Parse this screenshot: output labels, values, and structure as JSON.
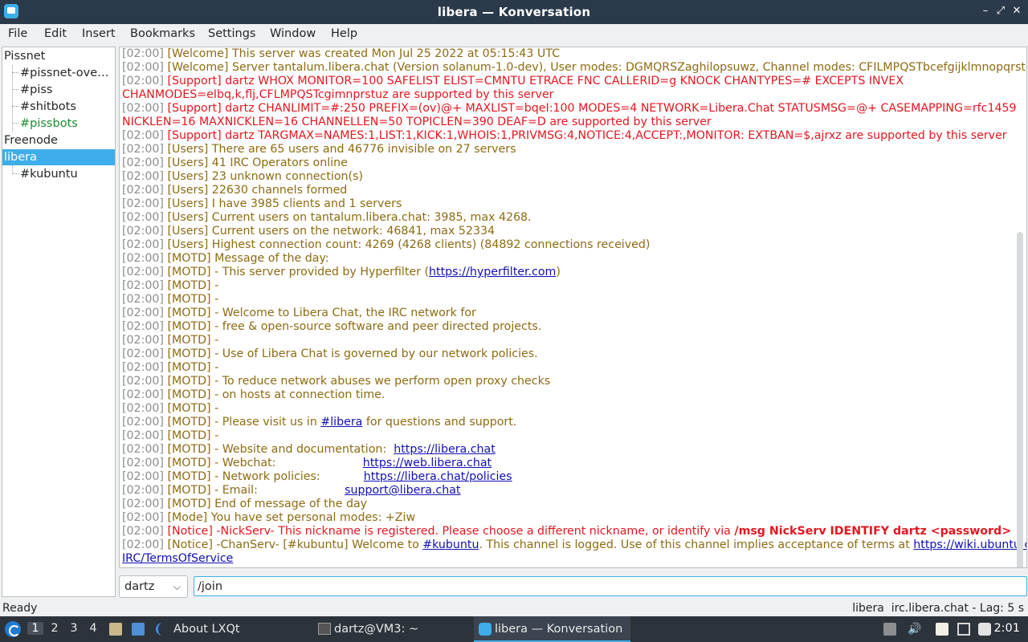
{
  "window": {
    "title": "libera — Konversation"
  },
  "menubar": [
    "File",
    "Edit",
    "Insert",
    "Bookmarks",
    "Settings",
    "Window",
    "Help"
  ],
  "tree": {
    "servers": [
      {
        "name": "Pissnet",
        "channels": [
          "#pissnet-over…",
          "#piss",
          "#shitbots",
          "#pissbots"
        ]
      },
      {
        "name": "Freenode",
        "channels": []
      },
      {
        "name": "libera",
        "channels": [
          "#kubuntu"
        ]
      }
    ]
  },
  "chat": {
    "lines": [
      {
        "ts": "[02:00]",
        "tag": "[Welcome]",
        "text": " This server was created Mon Jul 25 2022 at 05:15:43 UTC",
        "style": "info"
      },
      {
        "ts": "[02:00]",
        "tag": "[Welcome]",
        "text": " Server tantalum.libera.chat (Version solanum-1.0-dev), User modes: DGMQRSZaghilopsuwz, Channel modes: CFILMPQSTbcefgijklmnopqrstuvz",
        "style": "info"
      },
      {
        "ts": "[02:00]",
        "tag": "[Support]",
        "text": " dartz WHOX MONITOR=100 SAFELIST ELIST=CMNTU ETRACE FNC CALLERID=g KNOCK CHANTYPES=# EXCEPTS INVEX",
        "style": "err"
      },
      {
        "ts": "",
        "tag": "",
        "text": "CHANMODES=eIbq,k,flj,CFLMPQSTcgimnprstuz are supported by this server",
        "style": "err"
      },
      {
        "ts": "[02:00]",
        "tag": "[Support]",
        "text": " dartz CHANLIMIT=#:250 PREFIX=(ov)@+ MAXLIST=bqeI:100 MODES=4 NETWORK=Libera.Chat STATUSMSG=@+ CASEMAPPING=rfc1459",
        "style": "err"
      },
      {
        "ts": "",
        "tag": "",
        "text": "NICKLEN=16 MAXNICKLEN=16 CHANNELLEN=50 TOPICLEN=390 DEAF=D are supported by this server",
        "style": "err"
      },
      {
        "ts": "[02:00]",
        "tag": "[Support]",
        "text": " dartz TARGMAX=NAMES:1,LIST:1,KICK:1,WHOIS:1,PRIVMSG:4,NOTICE:4,ACCEPT:,MONITOR: EXTBAN=$,ajrxz are supported by this server",
        "style": "err"
      },
      {
        "ts": "[02:00]",
        "tag": "[Users]",
        "text": " There are 65 users and 46776 invisible on 27 servers",
        "style": "info"
      },
      {
        "ts": "[02:00]",
        "tag": "[Users]",
        "text": " 41 IRC Operators online",
        "style": "info"
      },
      {
        "ts": "[02:00]",
        "tag": "[Users]",
        "text": " 23 unknown connection(s)",
        "style": "info"
      },
      {
        "ts": "[02:00]",
        "tag": "[Users]",
        "text": " 22630 channels formed",
        "style": "info"
      },
      {
        "ts": "[02:00]",
        "tag": "[Users]",
        "text": " I have 3985 clients and 1 servers",
        "style": "info"
      },
      {
        "ts": "[02:00]",
        "tag": "[Users]",
        "text": " Current users on tantalum.libera.chat: 3985, max 4268.",
        "style": "info"
      },
      {
        "ts": "[02:00]",
        "tag": "[Users]",
        "text": " Current users on the network: 46841, max 52334",
        "style": "info"
      },
      {
        "ts": "[02:00]",
        "tag": "[Users]",
        "text": " Highest connection count: 4269 (4268 clients) (84892 connections received)",
        "style": "info"
      },
      {
        "ts": "[02:00]",
        "tag": "[MOTD]",
        "text": " Message of the day:",
        "style": "info"
      },
      {
        "ts": "[02:00]",
        "tag": "[MOTD]",
        "text": " - This server provided by Hyperfilter (",
        "link": "https://hyperfilter.com",
        "after": ")",
        "style": "info"
      },
      {
        "ts": "[02:00]",
        "tag": "[MOTD]",
        "text": " -",
        "style": "info"
      },
      {
        "ts": "[02:00]",
        "tag": "[MOTD]",
        "text": " -",
        "style": "info"
      },
      {
        "ts": "[02:00]",
        "tag": "[MOTD]",
        "text": " - Welcome to Libera Chat, the IRC network for",
        "style": "info"
      },
      {
        "ts": "[02:00]",
        "tag": "[MOTD]",
        "text": " - free & open-source software and peer directed projects.",
        "style": "info"
      },
      {
        "ts": "[02:00]",
        "tag": "[MOTD]",
        "text": " -",
        "style": "info"
      },
      {
        "ts": "[02:00]",
        "tag": "[MOTD]",
        "text": " - Use of Libera Chat is governed by our network policies.",
        "style": "info"
      },
      {
        "ts": "[02:00]",
        "tag": "[MOTD]",
        "text": " -",
        "style": "info"
      },
      {
        "ts": "[02:00]",
        "tag": "[MOTD]",
        "text": " - To reduce network abuses we perform open proxy checks",
        "style": "info"
      },
      {
        "ts": "[02:00]",
        "tag": "[MOTD]",
        "text": " - on hosts at connection time.",
        "style": "info"
      },
      {
        "ts": "[02:00]",
        "tag": "[MOTD]",
        "text": " -",
        "style": "info"
      },
      {
        "ts": "[02:00]",
        "tag": "[MOTD]",
        "text": " - Please visit us in ",
        "link": "#libera",
        "after": " for questions and support.",
        "style": "info"
      },
      {
        "ts": "[02:00]",
        "tag": "[MOTD]",
        "text": " -",
        "style": "info"
      },
      {
        "ts": "[02:00]",
        "tag": "[MOTD]",
        "text": " - Website and documentation:  ",
        "link": "https://libera.chat",
        "after": "",
        "style": "info"
      },
      {
        "ts": "[02:00]",
        "tag": "[MOTD]",
        "text": " - Webchat:                        ",
        "link": "https://web.libera.chat",
        "after": "",
        "style": "info"
      },
      {
        "ts": "[02:00]",
        "tag": "[MOTD]",
        "text": " - Network policies:            ",
        "link": "https://libera.chat/policies",
        "after": "",
        "style": "info"
      },
      {
        "ts": "[02:00]",
        "tag": "[MOTD]",
        "text": " - Email:                        ",
        "link": "support@libera.chat",
        "after": "",
        "style": "info"
      },
      {
        "ts": "[02:00]",
        "tag": "[MOTD]",
        "text": " End of message of the day",
        "style": "info"
      },
      {
        "ts": "[02:00]",
        "tag": "[Mode]",
        "text": " You have set personal modes: +Ziw",
        "style": "info"
      },
      {
        "ts": "[02:00]",
        "tag": "[Notice]",
        "text": " -NickServ- This nickname is registered. Please choose a different nickname, or identify via ",
        "bold": "/msg NickServ IDENTIFY dartz <password>",
        "style": "err"
      },
      {
        "ts": "[02:00]",
        "tag": "[Notice]",
        "text": " -ChanServ- [#kubuntu] Welcome to ",
        "link": "#kubuntu",
        "after": ". This channel is logged. Use of this channel implies acceptance of terms at ",
        "link2": "https://wiki.ubuntu.com/",
        "style": "info"
      },
      {
        "ts": "",
        "tag": "",
        "text": "",
        "link": "IRC/TermsOfService",
        "after": "",
        "style": "info"
      }
    ]
  },
  "input": {
    "nick": "dartz",
    "value": "/join "
  },
  "statusbar": {
    "left": "Ready",
    "right": "libera  irc.libera.chat - Lag: 5 s"
  },
  "panel": {
    "workspaces": [
      "1",
      "2",
      "3",
      "4"
    ],
    "tasks": [
      {
        "label": "About LXQt",
        "icon": "lxqt-icon"
      },
      {
        "label": "dartz@VM3: ~",
        "icon": "terminal-icon"
      },
      {
        "label": "libera — Konversation",
        "icon": "konversation-icon"
      }
    ],
    "clock": "2:01"
  }
}
